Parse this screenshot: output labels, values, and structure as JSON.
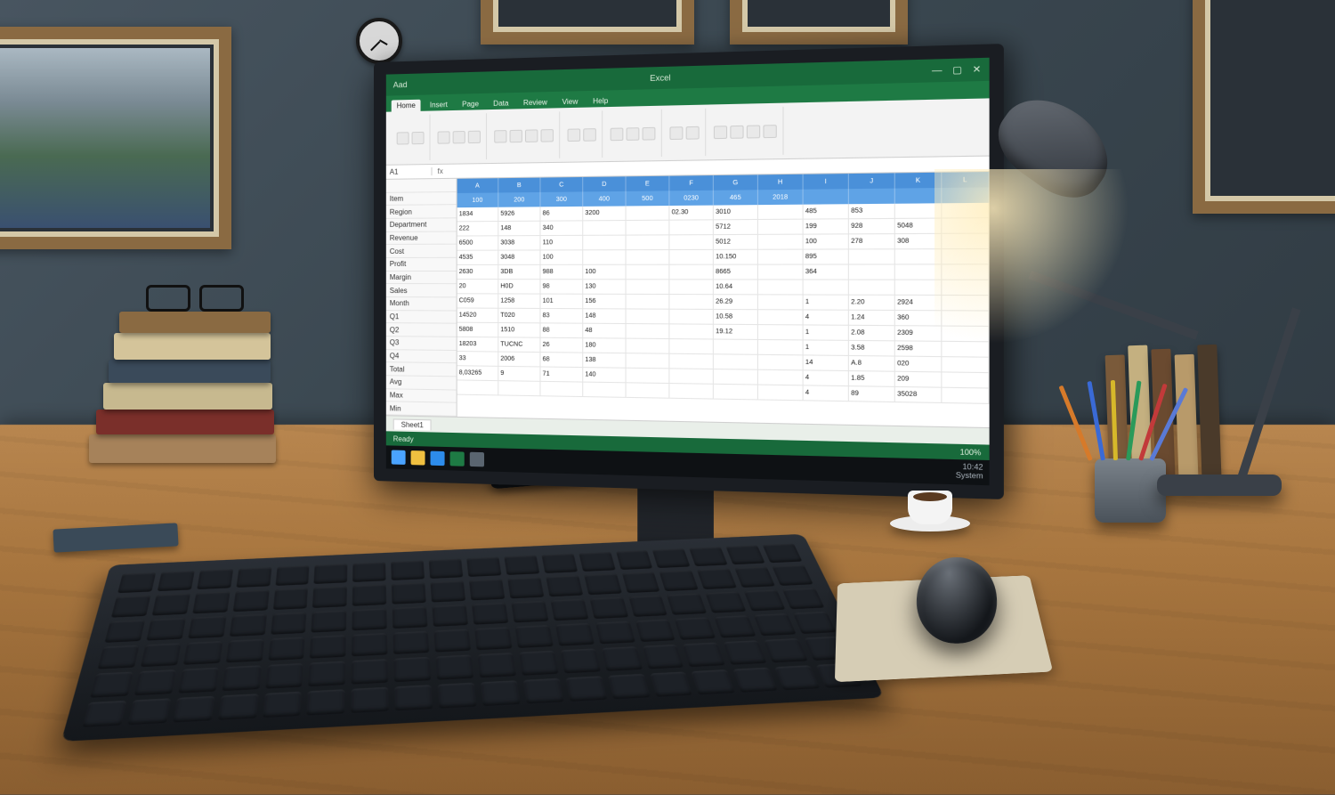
{
  "titlebar": {
    "left": "Aad",
    "center": "Excel",
    "min": "—",
    "max": "▢",
    "close": "✕"
  },
  "ribbon_tabs": [
    "Home",
    "Insert",
    "Page",
    "Data",
    "Review",
    "View",
    "Help"
  ],
  "formula": {
    "cell": "A1",
    "fx": "fx"
  },
  "row_labels": [
    "",
    "Item",
    "Region",
    "Department",
    "Revenue",
    "Cost",
    "Profit",
    "Margin",
    "Sales",
    "Month",
    "Q1",
    "Q2",
    "Q3",
    "Q4",
    "Total",
    "Avg",
    "Max",
    "Min"
  ],
  "col_headers": [
    "A",
    "B",
    "C",
    "D",
    "E",
    "F",
    "G",
    "H",
    "I",
    "J",
    "K",
    "L"
  ],
  "col_headers2": [
    "100",
    "200",
    "300",
    "400",
    "500",
    "0230",
    "465",
    "2018",
    "",
    "",
    "",
    ""
  ],
  "cells": [
    [
      "1834",
      "5926",
      "86",
      "3200",
      "",
      "02.30",
      "3010",
      "",
      "485",
      "853",
      "",
      ""
    ],
    [
      "222",
      "148",
      "340",
      "",
      "",
      "",
      "5712",
      "",
      "199",
      "928",
      "5048",
      ""
    ],
    [
      "6500",
      "3038",
      "110",
      "",
      "",
      "",
      "5012",
      "",
      "100",
      "278",
      "308",
      ""
    ],
    [
      "4535",
      "3048",
      "100",
      "",
      "",
      "",
      "10.150",
      "",
      "895",
      "",
      "",
      ""
    ],
    [
      "2630",
      "3DB",
      "988",
      "100",
      "",
      "",
      "8665",
      "",
      "364",
      "",
      "",
      ""
    ],
    [
      "20",
      "H0D",
      "98",
      "130",
      "",
      "",
      "10.64",
      "",
      "",
      "",
      "",
      ""
    ],
    [
      "C059",
      "1258",
      "101",
      "156",
      "",
      "",
      "26.29",
      "",
      "1",
      "2.20",
      "2924",
      ""
    ],
    [
      "14520",
      "T020",
      "83",
      "148",
      "",
      "",
      "10.58",
      "",
      "4",
      "1.24",
      "360",
      ""
    ],
    [
      "5808",
      "1510",
      "88",
      "48",
      "",
      "",
      "19.12",
      "",
      "1",
      "2.08",
      "2309",
      ""
    ],
    [
      "18203",
      "TUCNC",
      "26",
      "180",
      "",
      "",
      "",
      "",
      "1",
      "3.58",
      "2598",
      ""
    ],
    [
      "33",
      "2006",
      "68",
      "138",
      "",
      "",
      "",
      "",
      "14",
      "A.8",
      "020",
      ""
    ],
    [
      "8,03265",
      "9",
      "71",
      "140",
      "",
      "",
      "",
      "",
      "4",
      "1.85",
      "209",
      ""
    ],
    [
      "",
      "",
      "",
      "",
      "",
      "",
      "",
      "",
      "4",
      "89",
      "35028",
      ""
    ]
  ],
  "sheet": {
    "tab1": "Sheet1",
    "status_left": "Ready",
    "status_right": "100%"
  },
  "taskbar": {
    "time": "10:42",
    "label": "System"
  }
}
